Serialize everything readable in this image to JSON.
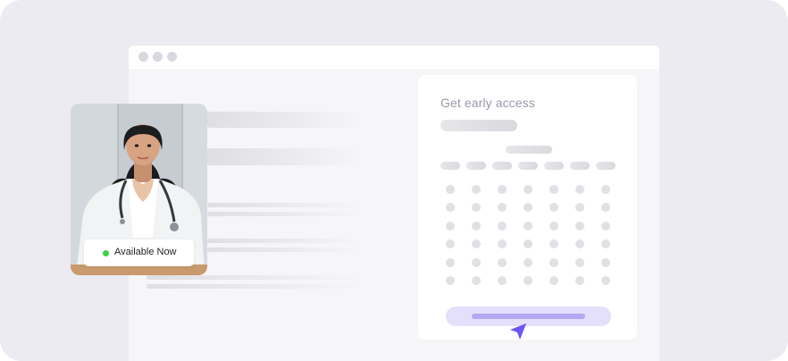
{
  "signup_card": {
    "title": "Get early access"
  },
  "doctor_card": {
    "status_label": "Available Now",
    "status_color": "#3bd14c",
    "avatar": "doctor-photo"
  },
  "colors": {
    "accent": "#6b57f5",
    "cta_fill": "#e4e0fb",
    "background": "#ecebf2"
  },
  "icons": {
    "window_controls": [
      "window-dot-icon",
      "window-dot-icon",
      "window-dot-icon"
    ],
    "cursor": "cursor-arrow-icon"
  }
}
